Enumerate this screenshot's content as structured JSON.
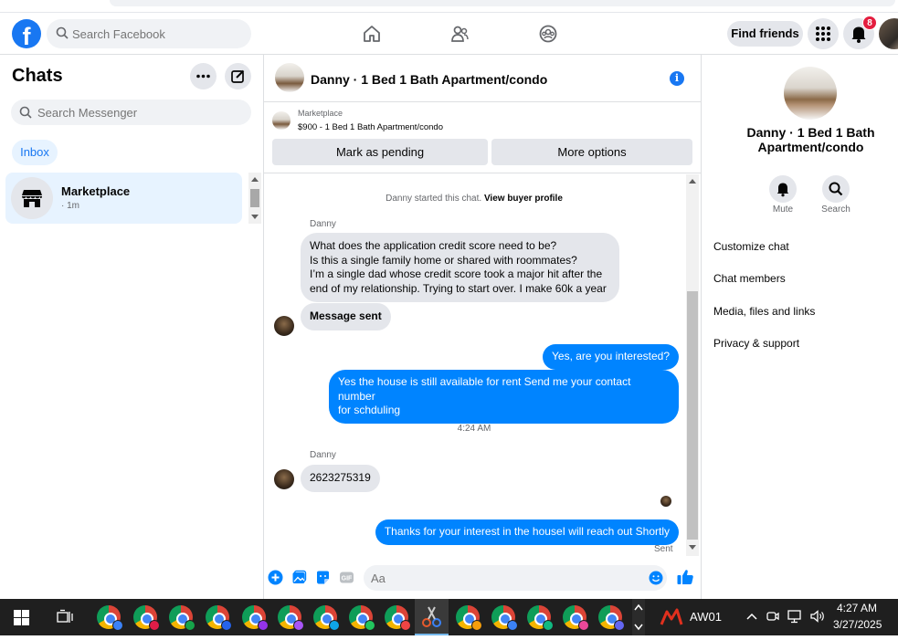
{
  "topnav": {
    "search_placeholder": "Search Facebook",
    "find_friends": "Find friends",
    "notif_count": "8"
  },
  "left": {
    "title": "Chats",
    "search_placeholder": "Search Messenger",
    "inbox": "Inbox",
    "chat": {
      "name": "Marketplace",
      "time": "· 1m"
    }
  },
  "conversation": {
    "title": "Danny · 1 Bed 1 Bath Apartment/condo",
    "marketplace_label": "Marketplace",
    "listing": "$900 - 1 Bed 1 Bath Apartment/condo",
    "mark_pending": "Mark as pending",
    "more_options": "More options",
    "system_text": "Danny started this chat. ",
    "system_link": "View buyer profile",
    "sender1": "Danny",
    "msg1_lines": [
      "What does the application credit score need to be?",
      "Is this a single family home or shared with roommates?",
      "I’m a single dad whose credit score took a major hit after the",
      "end of my relationship. Trying to start over. I make 60k a year"
    ],
    "msg2": "Message sent",
    "out1": "Yes, are you interested?",
    "out2_lines": [
      "Yes the house is still available for rent Send me your contact number",
      "for schduling"
    ],
    "timestamp": "4:24 AM",
    "sender2": "Danny",
    "msg3": "2623275319",
    "out3": "Thanks for your interest in the houseI will reach out Shortly",
    "status": "Sent",
    "composer_placeholder": "Aa"
  },
  "right": {
    "name_line1": "Danny · 1 Bed 1 Bath",
    "name_line2": "Apartment/condo",
    "mute": "Mute",
    "search": "Search",
    "items": [
      "Customize chat",
      "Chat members",
      "Media, files and links",
      "Privacy & support"
    ]
  },
  "taskbar": {
    "app_label": "AW01",
    "time": "4:27 AM",
    "date": "3/27/2025"
  },
  "colors": {
    "accent": "#1877f2",
    "bubble_out": "#0084ff",
    "bubble_in": "#e4e6eb",
    "badge": "#e41e3f"
  }
}
